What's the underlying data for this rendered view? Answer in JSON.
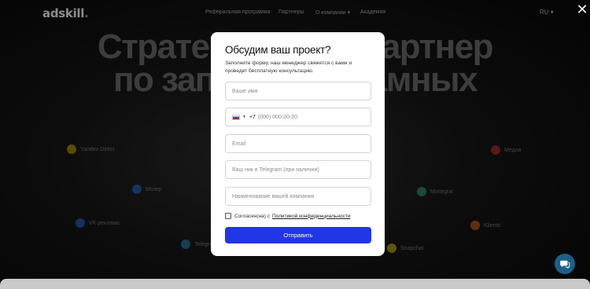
{
  "header": {
    "logo": "adskill",
    "nav": [
      "Реферальная программа",
      "Партнеры",
      "О компании ▾",
      "Академия"
    ],
    "language": "RU ▾"
  },
  "hero": {
    "line1": "Стратегический партнер",
    "line2": "по запуску рекламных"
  },
  "platforms": [
    {
      "label": "Yandex Direct",
      "icon": "yandex-direct-icon",
      "color": "#f2c200"
    },
    {
      "label": "Мозер",
      "icon": "mozer-icon",
      "color": "#2d7cf6"
    },
    {
      "label": "VK реклама",
      "icon": "vk-ads-icon",
      "color": "#2b78f0"
    },
    {
      "label": "Telegram",
      "icon": "telegram-icon",
      "color": "#2aa1de"
    },
    {
      "label": "Медиа",
      "icon": "media-icon",
      "color": "#e53935"
    },
    {
      "label": "Mintegral",
      "icon": "mintegral-icon",
      "color": "#3bbf8a"
    },
    {
      "label": "Klients",
      "icon": "klients-icon",
      "color": "#ff7a1a"
    },
    {
      "label": "Snapchat",
      "icon": "snapchat-icon",
      "color": "#f5e100"
    }
  ],
  "modal": {
    "title": "Обсудим ваш проект?",
    "subtitle": "Заполните форму, наш менеджер свяжется с вами и проведет бесплатную консультацию.",
    "fields": {
      "name_placeholder": "Ваше имя",
      "phone_code": "+7",
      "phone_placeholder": "(000) 000-00-00",
      "email_placeholder": "Email",
      "telegram_placeholder": "Ваш ник в Telegram (при наличии)",
      "company_placeholder": "Наименование вашей компании"
    },
    "consent_text": "Согласен(на) с",
    "consent_link": "Политикой конфиденциальности",
    "submit_label": "Отправить",
    "accent_color": "#2336e6"
  },
  "close_label": "✕"
}
